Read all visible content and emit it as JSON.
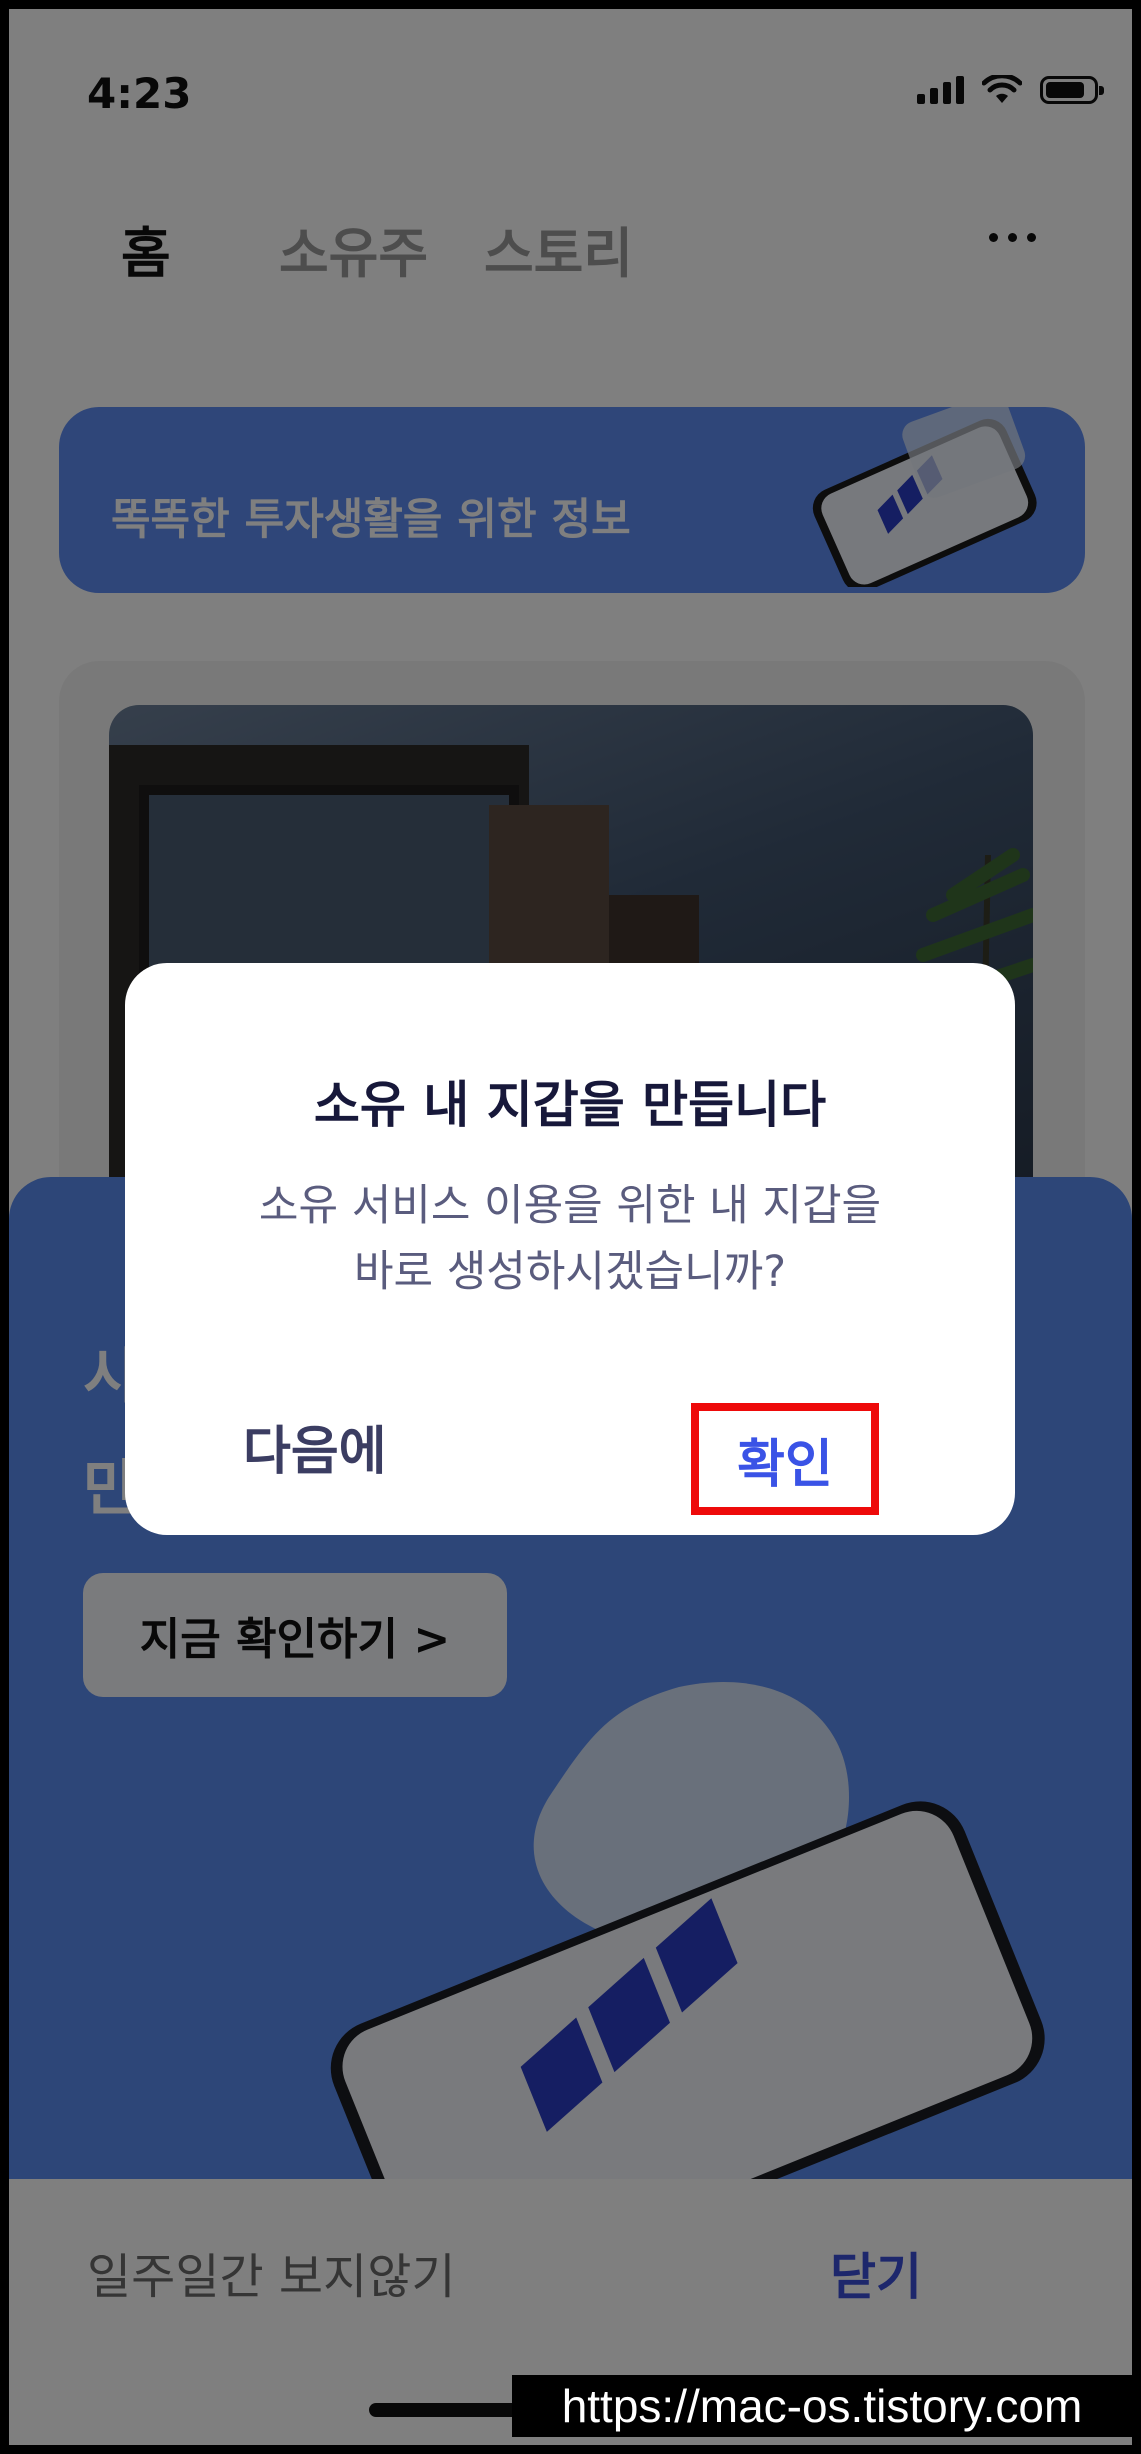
{
  "status_bar": {
    "time": "4:23"
  },
  "nav": {
    "tabs": [
      "홈",
      "소유주",
      "스토리"
    ],
    "active_tab": "홈",
    "more_icon": "ellipsis-icon"
  },
  "info_banner": {
    "text": "똑똑한 투자생활을 위한 정보"
  },
  "sheet": {
    "title_line1": "시",
    "title_line2": "만",
    "cta_label": "지금 확인하기 >",
    "footer_hide_label": "일주일간 보지않기",
    "footer_close_label": "닫기"
  },
  "dialog": {
    "title": "소유 내 지갑을 만듭니다",
    "message_line1": "소유 서비스 이용을 위한 내 지갑을",
    "message_line2": "바로 생성하시겠습니까?",
    "later_label": "다음에",
    "confirm_label": "확인"
  },
  "watermark": "https://mac-os.tistory.com",
  "colors": {
    "accent_blue": "#3a53e6",
    "banner_blue": "#5f8df3",
    "highlight_red": "#ee0a0a"
  }
}
